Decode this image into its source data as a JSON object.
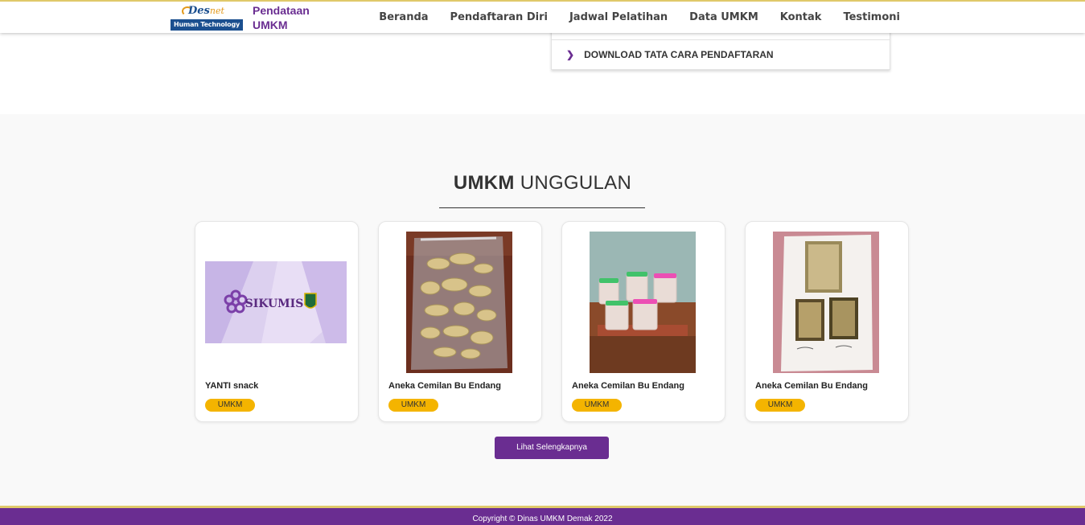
{
  "header": {
    "logo": {
      "word": "Des",
      "word_suffix": "net",
      "band": "Human Technology"
    },
    "brand": "Pendataan UMKM",
    "nav": [
      "Beranda",
      "Pendaftaran Diri",
      "Jadwal Pelatihan",
      "Data UMKM",
      "Kontak",
      "Testimoni"
    ]
  },
  "accordion": {
    "item": "DOWNLOAD TATA CARA PENDAFTARAN"
  },
  "section": {
    "title_bold": "UMKM",
    "title_rest": " UNGGULAN",
    "cards": [
      {
        "name": "YANTI snack",
        "badge": "UMKM",
        "image": "sikumis-banner"
      },
      {
        "name": "Aneka Cemilan Bu Endang",
        "badge": "UMKM",
        "image": "snack-bag-photo"
      },
      {
        "name": "Aneka Cemilan Bu Endang",
        "badge": "UMKM",
        "image": "jars-photo"
      },
      {
        "name": "Aneka Cemilan Bu Endang",
        "badge": "UMKM",
        "image": "flyer-photo"
      }
    ],
    "more_button": "Lihat Selengkapnya",
    "banner_text": "SIKUMIS"
  },
  "footer": {
    "copyright": "Copyright © Dinas UMKM Demak 2022"
  },
  "colors": {
    "primary": "#6a2d91",
    "badge": "#f4b400",
    "accent_line": "#e0c96a"
  }
}
